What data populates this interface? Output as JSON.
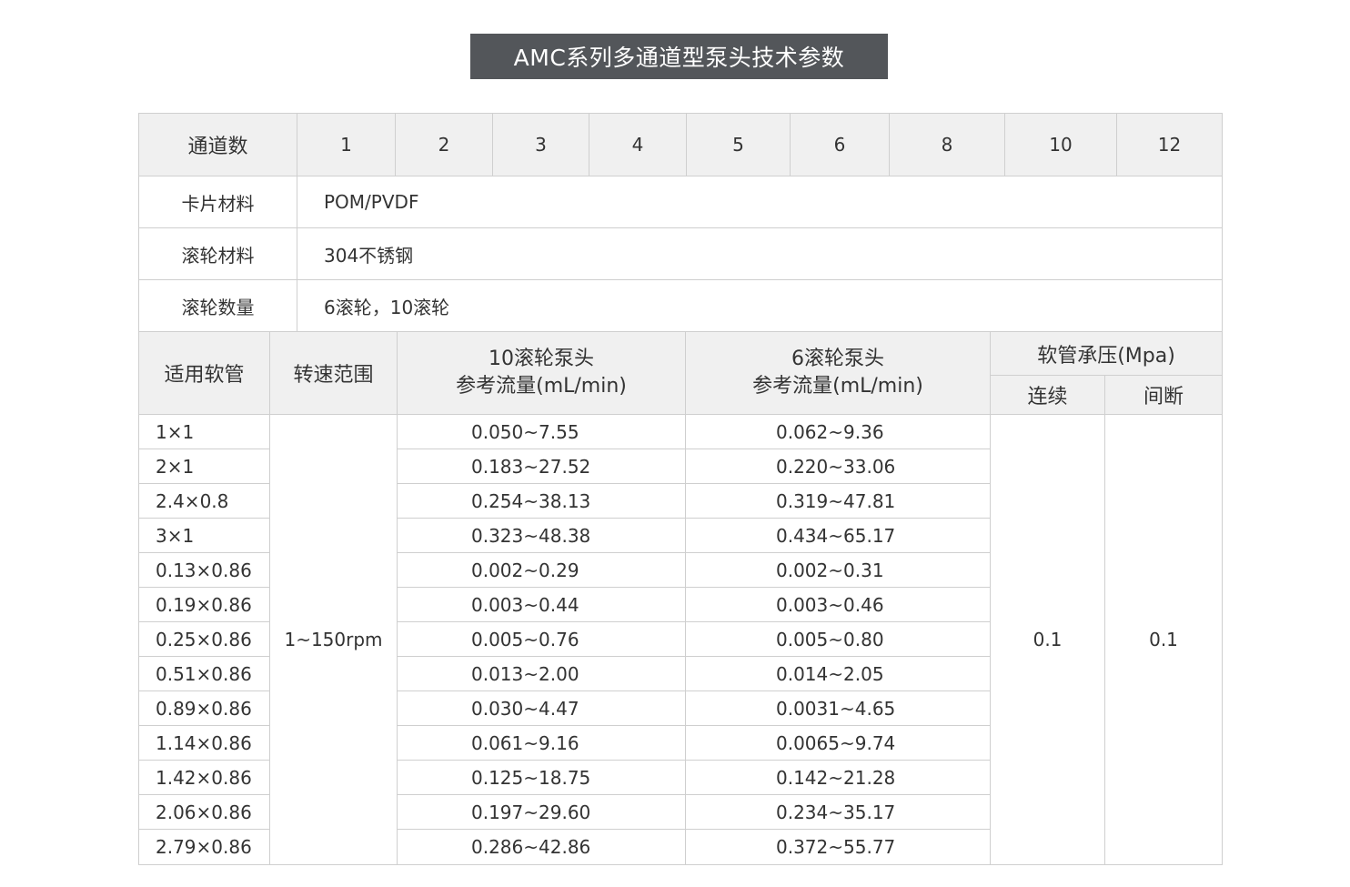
{
  "title": "AMC系列多通道型泵头技术参数",
  "spec_table": {
    "channels_label": "通道数",
    "channels": [
      "1",
      "2",
      "3",
      "4",
      "5",
      "6",
      "8",
      "10",
      "12"
    ],
    "rows": [
      {
        "label": "卡片材料",
        "value": "POM/PVDF"
      },
      {
        "label": "滚轮材料",
        "value": "304不锈钢"
      },
      {
        "label": "滚轮数量",
        "value": "6滚轮，10滚轮"
      }
    ]
  },
  "flow_table": {
    "headers": {
      "tubing": "适用软管",
      "speed": "转速范围",
      "flow10_line1": "10滚轮泵头",
      "flow10_line2": "参考流量(mL/min)",
      "flow6_line1": "6滚轮泵头",
      "flow6_line2": "参考流量(mL/min)",
      "pressure": "软管承压(Mpa)",
      "continuous": "连续",
      "intermittent": "间断"
    },
    "speed_range": "1~150rpm",
    "pressure_continuous": "0.1",
    "pressure_intermittent": "0.1",
    "rows": [
      {
        "tubing": "1×1",
        "flow10": "0.050~7.55",
        "flow6": "0.062~9.36"
      },
      {
        "tubing": "2×1",
        "flow10": "0.183~27.52",
        "flow6": "0.220~33.06"
      },
      {
        "tubing": "2.4×0.8",
        "flow10": "0.254~38.13",
        "flow6": "0.319~47.81"
      },
      {
        "tubing": "3×1",
        "flow10": "0.323~48.38",
        "flow6": "0.434~65.17"
      },
      {
        "tubing": "0.13×0.86",
        "flow10": "0.002~0.29",
        "flow6": "0.002~0.31"
      },
      {
        "tubing": "0.19×0.86",
        "flow10": "0.003~0.44",
        "flow6": "0.003~0.46"
      },
      {
        "tubing": "0.25×0.86",
        "flow10": "0.005~0.76",
        "flow6": "0.005~0.80"
      },
      {
        "tubing": "0.51×0.86",
        "flow10": "0.013~2.00",
        "flow6": "0.014~2.05"
      },
      {
        "tubing": "0.89×0.86",
        "flow10": "0.030~4.47",
        "flow6": "0.0031~4.65"
      },
      {
        "tubing": "1.14×0.86",
        "flow10": "0.061~9.16",
        "flow6": "0.0065~9.74"
      },
      {
        "tubing": "1.42×0.86",
        "flow10": "0.125~18.75",
        "flow6": "0.142~21.28"
      },
      {
        "tubing": "2.06×0.86",
        "flow10": "0.197~29.60",
        "flow6": "0.234~35.17"
      },
      {
        "tubing": "2.79×0.86",
        "flow10": "0.286~42.86",
        "flow6": "0.372~55.77"
      }
    ]
  }
}
